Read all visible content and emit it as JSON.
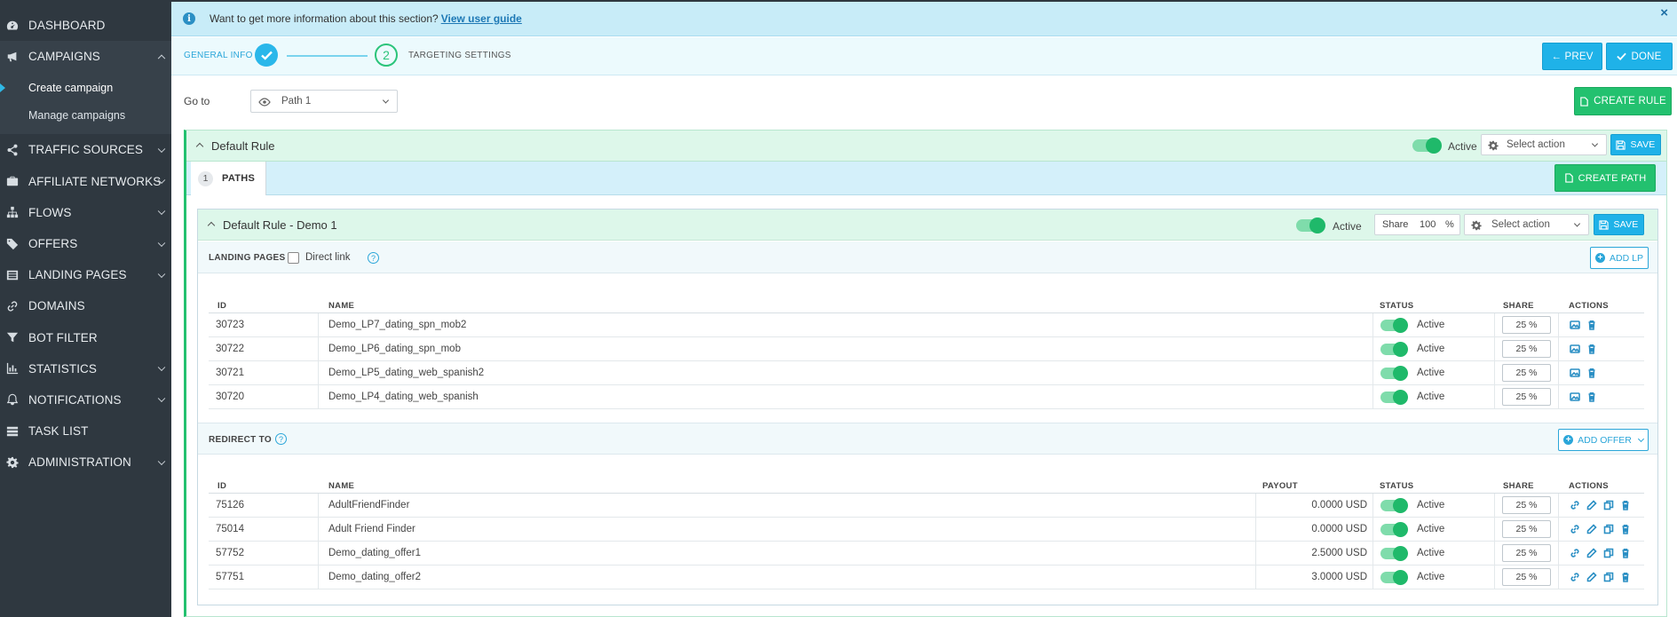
{
  "sidebar": {
    "items": [
      {
        "label": "DASHBOARD",
        "icon": "dashboard-icon"
      },
      {
        "label": "CAMPAIGNS",
        "icon": "megaphone-icon"
      },
      {
        "label": "TRAFFIC SOURCES",
        "icon": "share-icon"
      },
      {
        "label": "AFFILIATE NETWORKS",
        "icon": "briefcase-icon"
      },
      {
        "label": "FLOWS",
        "icon": "sitemap-icon"
      },
      {
        "label": "OFFERS",
        "icon": "tag-icon"
      },
      {
        "label": "LANDING PAGES",
        "icon": "list-icon"
      },
      {
        "label": "DOMAINS",
        "icon": "link-icon"
      },
      {
        "label": "BOT FILTER",
        "icon": "filter-icon"
      },
      {
        "label": "STATISTICS",
        "icon": "bar-chart-icon"
      },
      {
        "label": "NOTIFICATIONS",
        "icon": "bell-icon"
      },
      {
        "label": "TASK LIST",
        "icon": "tasks-icon"
      },
      {
        "label": "ADMINISTRATION",
        "icon": "gear-icon"
      }
    ],
    "campaigns_sub": [
      "Create campaign",
      "Manage campaigns"
    ]
  },
  "infobar": {
    "text": "Want to get more information about this section?",
    "link": "View user guide",
    "close": "×"
  },
  "steps": {
    "step1": "GENERAL INFO",
    "step2_num": "2",
    "step2": "TARGETING SETTINGS"
  },
  "toolbar": {
    "prev": "← PREV",
    "done": "DONE",
    "create_rule": "CREATE RULE"
  },
  "goto": {
    "label": "Go to",
    "value": "Path 1"
  },
  "rule": {
    "title": "Default Rule",
    "active": "Active",
    "select_action": "Select action",
    "save": "SAVE"
  },
  "tabs": {
    "count": "1",
    "label": "PATHS",
    "create_path": "CREATE PATH"
  },
  "path": {
    "title": "Default Rule - Demo 1",
    "active": "Active",
    "share_label": "Share",
    "share_value": "100",
    "share_unit": "%",
    "select_action": "Select action",
    "save": "SAVE"
  },
  "landing": {
    "title": "LANDING PAGES",
    "direct_link": "Direct link",
    "help": "?",
    "add": "ADD LP",
    "columns": {
      "id": "ID",
      "name": "NAME",
      "status": "STATUS",
      "share": "SHARE",
      "actions": "ACTIONS"
    },
    "rows": [
      {
        "id": "30723",
        "name": "Demo_LP7_dating_spn_mob2",
        "status": "Active",
        "share": "25 %"
      },
      {
        "id": "30722",
        "name": "Demo_LP6_dating_spn_mob",
        "status": "Active",
        "share": "25 %"
      },
      {
        "id": "30721",
        "name": "Demo_LP5_dating_web_spanish2",
        "status": "Active",
        "share": "25 %"
      },
      {
        "id": "30720",
        "name": "Demo_LP4_dating_web_spanish",
        "status": "Active",
        "share": "25 %"
      }
    ]
  },
  "redirect": {
    "title": "REDIRECT TO",
    "help": "?",
    "add": "ADD OFFER",
    "columns": {
      "id": "ID",
      "name": "NAME",
      "payout": "PAYOUT",
      "status": "STATUS",
      "share": "SHARE",
      "actions": "ACTIONS"
    },
    "rows": [
      {
        "id": "75126",
        "name": "AdultFriendFinder",
        "payout": "0.0000 USD",
        "status": "Active",
        "share": "25 %"
      },
      {
        "id": "75014",
        "name": "Adult Friend Finder",
        "payout": "0.0000 USD",
        "status": "Active",
        "share": "25 %"
      },
      {
        "id": "57752",
        "name": "Demo_dating_offer1",
        "payout": "2.5000 USD",
        "status": "Active",
        "share": "25 %"
      },
      {
        "id": "57751",
        "name": "Demo_dating_offer2",
        "payout": "3.0000 USD",
        "status": "Active",
        "share": "25 %"
      }
    ]
  },
  "colors": {
    "accent_blue": "#1fb2e8",
    "accent_green": "#23c16f",
    "sidebar_bg": "#2f3840"
  }
}
